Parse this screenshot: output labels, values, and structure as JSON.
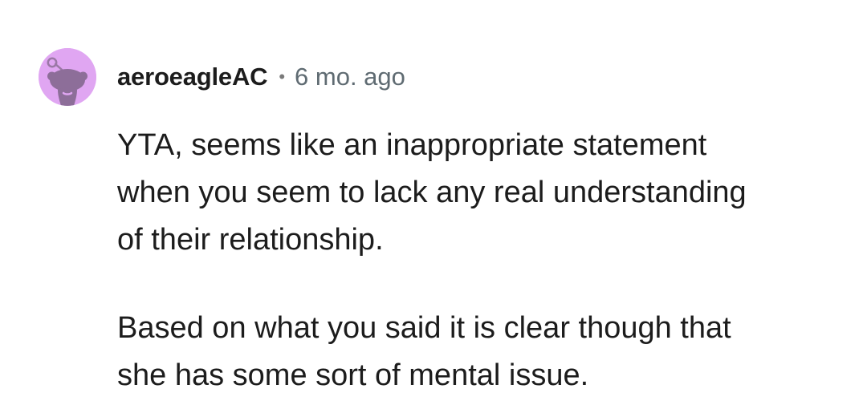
{
  "comment": {
    "author": "aeroeagleAC",
    "separator": "•",
    "timestamp": "6 mo. ago",
    "avatar_icon": "reddit-snoo-avatar-icon",
    "avatar_color": "#e0a6f2",
    "paragraphs": [
      "YTA, seems like an inappropriate statement\nwhen you seem to lack any real understanding\nof their relationship.",
      "Based on what you said it is clear though that\nshe has some sort of mental issue."
    ]
  }
}
